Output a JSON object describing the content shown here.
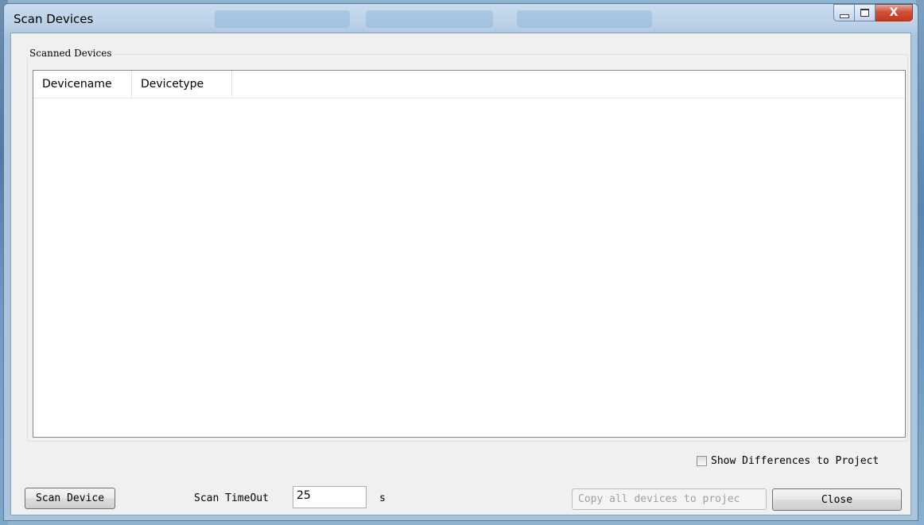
{
  "window": {
    "title": "Scan Devices",
    "close_glyph": "X"
  },
  "group": {
    "label": "Scanned Devices"
  },
  "table": {
    "columns": [
      "Devicename",
      "Devicetype"
    ],
    "rows": []
  },
  "options": {
    "show_differences_label": "Show Differences to Project",
    "show_differences_checked": false
  },
  "footer": {
    "scan_button": "Scan Device",
    "timeout_label": "Scan TimeOut",
    "timeout_value": "25",
    "timeout_unit": "s",
    "copy_button": "Copy all devices to projec",
    "close_button": "Close"
  }
}
